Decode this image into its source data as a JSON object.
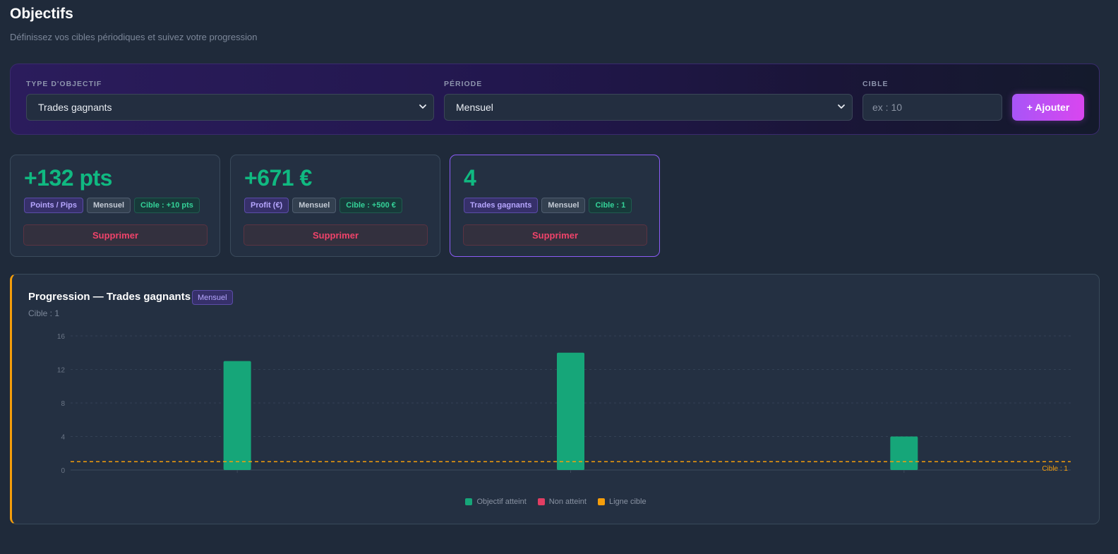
{
  "header": {
    "title": "Objectifs",
    "subtitle": "Définissez vos cibles périodiques et suivez votre progression"
  },
  "form": {
    "type_label": "TYPE D'OBJECTIF",
    "type_value": "Trades gagnants",
    "period_label": "PÉRIODE",
    "period_value": "Mensuel",
    "target_label": "CIBLE",
    "target_placeholder": "ex : 10",
    "add_label": "+ Ajouter"
  },
  "cards": [
    {
      "value": "+132 pts",
      "type": "Points / Pips",
      "period": "Mensuel",
      "target": "Cible : +10 pts",
      "delete_label": "Supprimer"
    },
    {
      "value": "+671 €",
      "type": "Profit (€)",
      "period": "Mensuel",
      "target": "Cible : +500 €",
      "delete_label": "Supprimer"
    },
    {
      "value": "4",
      "type": "Trades gagnants",
      "period": "Mensuel",
      "target": "Cible : 1",
      "delete_label": "Supprimer"
    }
  ],
  "chart_panel": {
    "title": "Progression — Trades gagnants",
    "period_badge": "Mensuel",
    "target_note": "Cible : 1"
  },
  "chart_data": {
    "type": "bar",
    "categories": [
      "",
      "",
      ""
    ],
    "values": [
      13,
      14,
      4
    ],
    "target": 1,
    "target_label": "Cible : 1",
    "ylim": [
      0,
      16
    ],
    "yticks": [
      0,
      4,
      8,
      12,
      16
    ],
    "grid": true,
    "legend": {
      "placement": "bottom-center",
      "entries": [
        "Objectif atteint",
        "Non atteint",
        "Ligne cible"
      ]
    },
    "colors": {
      "achieved": "#16a679",
      "not_achieved": "#e23e63",
      "target_line": "#f59e0b"
    }
  },
  "colors": {
    "accent_purple": "#a855f7",
    "accent_green": "#10b981",
    "danger": "#f0436a",
    "warning": "#f59e0b"
  }
}
